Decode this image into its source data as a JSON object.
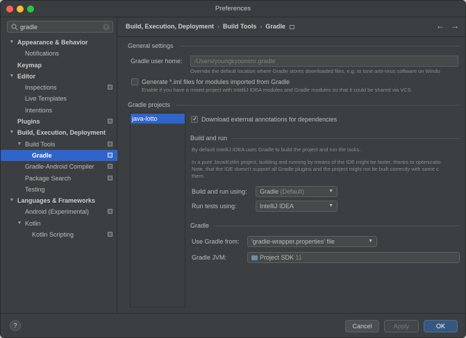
{
  "window": {
    "title": "Preferences"
  },
  "search": {
    "value": "gradle"
  },
  "sidebar": {
    "items": [
      {
        "label": "Appearance & Behavior"
      },
      {
        "label": "Notifications"
      },
      {
        "label": "Keymap"
      },
      {
        "label": "Editor"
      },
      {
        "label": "Inspections"
      },
      {
        "label": "Live Templates"
      },
      {
        "label": "Intentions"
      },
      {
        "label": "Plugins"
      },
      {
        "label": "Build, Execution, Deployment"
      },
      {
        "label": "Build Tools"
      },
      {
        "label": "Gradle"
      },
      {
        "label": "Gradle-Android Compiler"
      },
      {
        "label": "Package Search"
      },
      {
        "label": "Testing"
      },
      {
        "label": "Languages & Frameworks"
      },
      {
        "label": "Android (Experimental)"
      },
      {
        "label": "Kotlin"
      },
      {
        "label": "Kotlin Scripting"
      }
    ]
  },
  "breadcrumb": {
    "part1": "Build, Execution, Deployment",
    "part2": "Build Tools",
    "part3": "Gradle"
  },
  "general": {
    "title": "General settings",
    "user_home_label": "Gradle user home:",
    "user_home_value": "/Users/youngkyoonim/.gradle",
    "user_home_hint": "Override the default location where Gradle stores downloaded files, e.g. to tune anti-virus software on Windo",
    "iml_label": "Generate *.iml files for modules imported from Gradle",
    "iml_hint": "Enable if you have a mixed project with IntelliJ IDEA modules and Gradle modules so that it could be shared via VCS"
  },
  "projects": {
    "title": "Gradle projects",
    "items": [
      "java-lotto"
    ],
    "download_annotations_label": "Download external annotations for dependencies"
  },
  "build_and_run": {
    "title": "Build and run",
    "hint1": "By default IntelliJ IDEA uses Gradle to build the project and run the tasks.",
    "hint2": "In a pure Java/Kotlin project, building and running by means of the IDE might be faster, thanks to optimizatio",
    "hint3": "Note, that the IDE doesn't support all Gradle plugins and the project might not be built correctly with some c",
    "hint4": "them.",
    "build_run_label": "Build and run using:",
    "build_run_value": "Gradle",
    "build_run_suffix": "(Default)",
    "run_tests_label": "Run tests using:",
    "run_tests_value": "IntelliJ IDEA"
  },
  "gradle": {
    "title": "Gradle",
    "use_from_label": "Use Gradle from:",
    "use_from_value": "'gradle-wrapper.properties' file",
    "jvm_label": "Gradle JVM:",
    "jvm_value": "Project SDK",
    "jvm_version": "11"
  },
  "footer": {
    "help": "?",
    "cancel": "Cancel",
    "apply": "Apply",
    "ok": "OK"
  }
}
